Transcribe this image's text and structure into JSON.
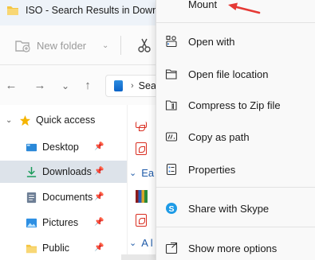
{
  "window": {
    "title": "ISO - Search Results in Downloads"
  },
  "toolbar": {
    "new_folder_label": "New folder",
    "dropdown_glyph": "⌄"
  },
  "navbar": {
    "back_glyph": "←",
    "forward_glyph": "→",
    "recent_glyph": "⌄",
    "up_glyph": "↑",
    "address_text": "Sea",
    "address_chevron": "›"
  },
  "sidebar": {
    "quick_access_label": "Quick access",
    "items": [
      {
        "label": "Desktop",
        "icon": "desktop-icon"
      },
      {
        "label": "Downloads",
        "icon": "download-icon",
        "selected": true
      },
      {
        "label": "Documents",
        "icon": "documents-icon"
      },
      {
        "label": "Pictures",
        "icon": "pictures-icon"
      },
      {
        "label": "Public",
        "icon": "folder-icon"
      }
    ]
  },
  "content": {
    "group_1": "Ea",
    "group_2": "A l"
  },
  "context_menu": {
    "items": [
      {
        "label": "Mount",
        "icon": "mount-icon"
      },
      {
        "label": "Open with",
        "icon": "open-with-icon"
      },
      {
        "label": "Open file location",
        "icon": "folder-open-icon"
      },
      {
        "label": "Compress to Zip file",
        "icon": "zip-icon"
      },
      {
        "label": "Copy as path",
        "icon": "copy-path-icon"
      },
      {
        "label": "Properties",
        "icon": "properties-icon"
      },
      {
        "label": "Share with Skype",
        "icon": "skype-icon"
      },
      {
        "label": "Show more options",
        "icon": "more-options-icon"
      }
    ]
  },
  "colors": {
    "accent": "#0067c0",
    "arrow": "#e53935",
    "selected_bg": "#dde3ea",
    "menu_bg": "#f9f9f9"
  }
}
